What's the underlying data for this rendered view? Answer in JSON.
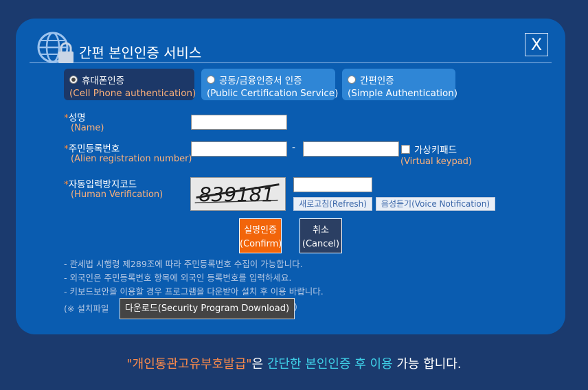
{
  "modal": {
    "title": "간편 본인인증 서비스",
    "close_label": "X"
  },
  "tabs": [
    {
      "label": "휴대폰인증",
      "sub": "(Cell Phone authentication)",
      "selected": true
    },
    {
      "label": "공동/금융인증서 인증",
      "sub": "(Public Certification Service)",
      "selected": false
    },
    {
      "label": "간편인증",
      "sub": "(Simple Authentication)",
      "selected": false
    }
  ],
  "form": {
    "name_label": "성명",
    "name_sub": "(Name)",
    "reg_label": "주민등록번호",
    "reg_sub": "(Alien registration number)",
    "reg_dash": "-",
    "keypad_label": "가상키패드",
    "keypad_sub": "(Virtual keypad)",
    "captcha_label": "자동입력방지코드",
    "captcha_sub": "(Human Verification)",
    "captcha_text": "839181",
    "refresh_label": "새로고침(Refresh)",
    "voice_label": "음성듣기(Voice Notification)",
    "star": "*"
  },
  "buttons": {
    "confirm_l1": "실명인증",
    "confirm_l2": "(Confirm)",
    "cancel_l1": "취소",
    "cancel_l2": "(Cancel)"
  },
  "notes": [
    "- 관세법 시행령 제289조에 따라 주민등록번호 수집이 가능합니다.",
    "- 외국인은 주민등록번호 항목에 외국인 등록번호를 입력하세요.",
    "- 키보드보안을 이용할 경우 프로그램을 다운받아 설치 후 이용 바랍니다."
  ],
  "install": {
    "prefix": "(※ 설치파일",
    "button": "다운로드(Security Program Download)",
    "suffix": ")"
  },
  "footer": {
    "quoted": "\"개인통관고유부호발급\"",
    "part2": "은 ",
    "highlight": "간단한 본인인증 후 이용",
    "part3": " 가능 합니다."
  },
  "colors": {
    "modal_bg": "#0a5cb0",
    "page_bg": "#1b3a6e",
    "accent_orange": "#f2650a",
    "active_tab": "#1c3868",
    "tab": "#2f86d6"
  }
}
